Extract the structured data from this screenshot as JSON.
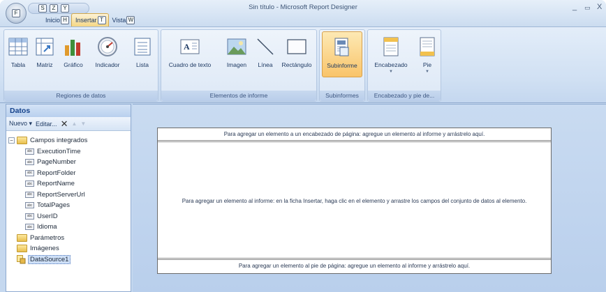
{
  "window": {
    "title": "Sin título - Microsoft Report Designer",
    "minimize": "_",
    "maximize": "▭",
    "close": "X",
    "office_key": "F"
  },
  "qat": {
    "keys": [
      "S",
      "Z",
      "Y"
    ]
  },
  "tabs": [
    {
      "label": "Inicio",
      "key": "H"
    },
    {
      "label": "Insertar",
      "key": "T"
    },
    {
      "label": "Vista",
      "key": "W"
    }
  ],
  "ribbon": {
    "groups": [
      {
        "label": "Regiones de datos",
        "buttons": [
          "Tabla",
          "Matriz",
          "Gráfico",
          "Indicador",
          "Lista"
        ]
      },
      {
        "label": "Elementos de informe",
        "buttons": [
          "Cuadro de texto",
          "Imagen",
          "Línea",
          "Rectángulo"
        ]
      },
      {
        "label": "Subinformes",
        "buttons": [
          "Subinforme"
        ]
      },
      {
        "label": "Encabezado y pie de...",
        "buttons": [
          "Encabezado",
          "Pie"
        ]
      }
    ]
  },
  "data_panel": {
    "title": "Datos",
    "new_label": "Nuevo",
    "edit_label": "Editar...",
    "tree": {
      "builtin": "Campos integrados",
      "fields": [
        "ExecutionTime",
        "PageNumber",
        "ReportFolder",
        "ReportName",
        "ReportServerUrl",
        "TotalPages",
        "UserID",
        "Idioma"
      ],
      "parameters": "Parámetros",
      "images": "Imágenes",
      "datasource": "DataSource1"
    },
    "field_icon_text": "abc"
  },
  "report": {
    "header_hint": "Para agregar un elemento a un encabezado de página: agregue un elemento al informe y arrástrelo aquí.",
    "body_hint": "Para agregar un elemento al informe: en la ficha Insertar, haga clic en el elemento y arrastre los campos del conjunto de datos al elemento.",
    "footer_hint": "Para agregar un elemento al pie de página: agregue un elemento al informe y arrástrelo aquí."
  }
}
